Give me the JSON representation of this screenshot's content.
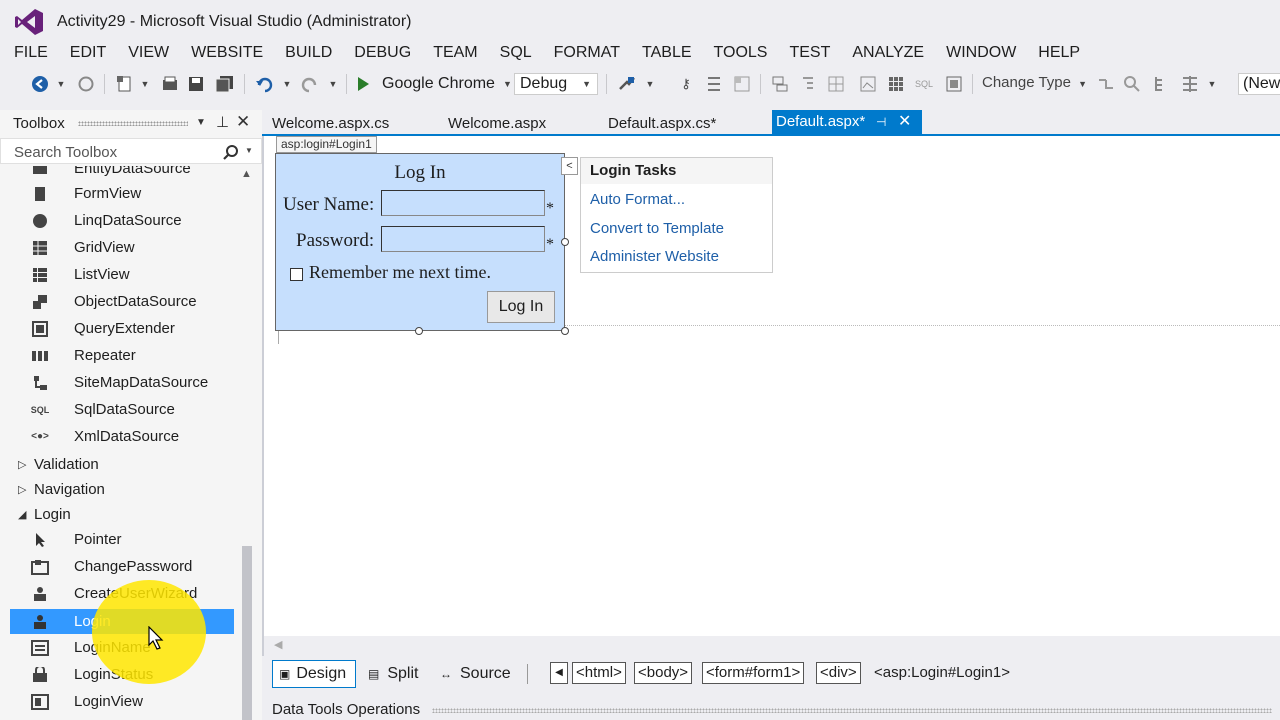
{
  "window": {
    "title": "Activity29 - Microsoft Visual Studio (Administrator)"
  },
  "menu": [
    "FILE",
    "EDIT",
    "VIEW",
    "WEBSITE",
    "BUILD",
    "DEBUG",
    "TEAM",
    "SQL",
    "FORMAT",
    "TABLE",
    "TOOLS",
    "TEST",
    "ANALYZE",
    "WINDOW",
    "HELP"
  ],
  "toolbar": {
    "browser_label": "Google Chrome",
    "config_value": "Debug",
    "change_type_label": "Change Type",
    "new_label": "(New"
  },
  "toolbox": {
    "title": "Toolbox",
    "search_placeholder": "Search Toolbox",
    "items": [
      {
        "label": "EntityDataSource",
        "icon": "entity-datasource-icon"
      },
      {
        "label": "FormView",
        "icon": "formview-icon"
      },
      {
        "label": "LinqDataSource",
        "icon": "linq-datasource-icon"
      },
      {
        "label": "GridView",
        "icon": "gridview-icon"
      },
      {
        "label": "ListView",
        "icon": "listview-icon"
      },
      {
        "label": "ObjectDataSource",
        "icon": "object-datasource-icon"
      },
      {
        "label": "QueryExtender",
        "icon": "query-extender-icon"
      },
      {
        "label": "Repeater",
        "icon": "repeater-icon"
      },
      {
        "label": "SiteMapDataSource",
        "icon": "sitemap-datasource-icon"
      },
      {
        "label": "SqlDataSource",
        "icon": "sql-datasource-icon"
      },
      {
        "label": "XmlDataSource",
        "icon": "xml-datasource-icon"
      }
    ],
    "groups": {
      "validation": "Validation",
      "navigation": "Navigation",
      "login": "Login"
    },
    "login_items": [
      {
        "label": "Pointer",
        "icon": "pointer-icon"
      },
      {
        "label": "ChangePassword",
        "icon": "change-password-icon"
      },
      {
        "label": "CreateUserWizard",
        "icon": "create-user-wizard-icon"
      },
      {
        "label": "Login",
        "icon": "login-icon"
      },
      {
        "label": "LoginName",
        "icon": "login-name-icon"
      },
      {
        "label": "LoginStatus",
        "icon": "login-status-icon"
      },
      {
        "label": "LoginView",
        "icon": "login-view-icon"
      }
    ],
    "selected_item": "Login"
  },
  "tabs": [
    {
      "label": "Welcome.aspx.cs"
    },
    {
      "label": "Welcome.aspx"
    },
    {
      "label": "Default.aspx.cs*"
    },
    {
      "label": "Default.aspx*"
    }
  ],
  "designer": {
    "control_tag": "asp:login#Login1",
    "login": {
      "heading": "Log In",
      "user_label": "User Name:",
      "password_label": "Password:",
      "required_marker": "*",
      "remember_label": "Remember me next time.",
      "button_label": "Log In"
    },
    "tasks": {
      "header": "Login Tasks",
      "links": [
        "Auto Format...",
        "Convert to Template",
        "Administer Website"
      ]
    }
  },
  "bottom": {
    "views": [
      "Design",
      "Split",
      "Source"
    ],
    "breadcrumbs": [
      "<html>",
      "<body>",
      "<form#form1>",
      "<div>"
    ],
    "current_element": "<asp:Login#Login1>"
  },
  "data_tools": {
    "label": "Data Tools Operations"
  },
  "colors": {
    "accent": "#007acc",
    "selection": "#3399ff",
    "login_bg": "#c6dffd",
    "spotlight": "#ffe600"
  }
}
